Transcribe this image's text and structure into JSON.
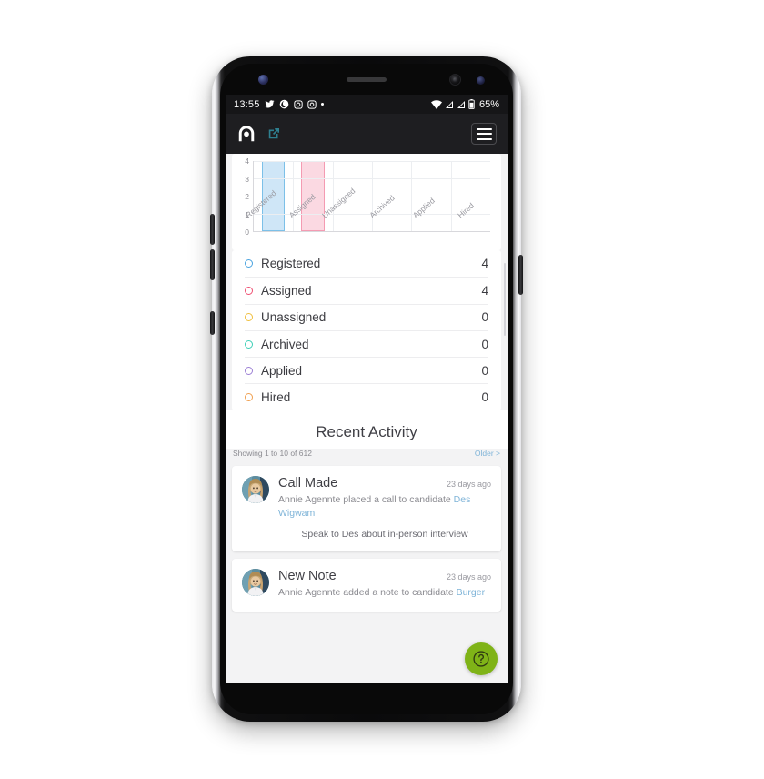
{
  "status_bar": {
    "time": "13:55",
    "battery_percent": "65%",
    "icons": [
      "twitter-icon",
      "vodafone-icon",
      "instagram-icon",
      "instagram-icon",
      "dot-icon"
    ],
    "right_icons": [
      "wifi-icon",
      "signal-icon",
      "signal-icon",
      "battery-icon"
    ]
  },
  "app_bar": {
    "logo": "app-logo-icon",
    "external_link": "external-link-icon",
    "menu": "hamburger-menu-icon"
  },
  "chart_data": {
    "type": "bar",
    "title": "",
    "categories": [
      "Registered",
      "Assigned",
      "Unassigned",
      "Archived",
      "Applied",
      "Hired"
    ],
    "values": [
      4,
      4,
      0,
      0,
      0,
      0
    ],
    "bar_colors": [
      "#cfe6f7",
      "#fbd9e2",
      "#fdeec2",
      "#c9efe6",
      "#ddd4f2",
      "#fae0c4"
    ],
    "bar_borders": [
      "#7cc0e8",
      "#f49bb2",
      "#f3cf6d",
      "#6fd4bf",
      "#b39ddb",
      "#efb06a"
    ],
    "yticks": [
      "0",
      "1",
      "2",
      "3",
      "4"
    ],
    "ylim": [
      0,
      4
    ],
    "xlabel": "",
    "ylabel": "",
    "grid": true,
    "legend_position": "below-as-list"
  },
  "stats": {
    "rows": [
      {
        "label": "Registered",
        "value": "4",
        "color": "#4aa3df"
      },
      {
        "label": "Assigned",
        "value": "4",
        "color": "#ef4f72"
      },
      {
        "label": "Unassigned",
        "value": "0",
        "color": "#f0c040"
      },
      {
        "label": "Archived",
        "value": "0",
        "color": "#3ecfb7"
      },
      {
        "label": "Applied",
        "value": "0",
        "color": "#9b7fd4"
      },
      {
        "label": "Hired",
        "value": "0",
        "color": "#f0a050"
      }
    ]
  },
  "recent_activity": {
    "heading": "Recent Activity",
    "showing_text": "Showing 1 to 10 of 612",
    "older_link": "Older >",
    "items": [
      {
        "avatar": "user-avatar",
        "title": "Call Made",
        "time": "23 days ago",
        "desc_prefix": "Annie Agennte placed a call to candidate ",
        "desc_link": "Des Wigwam",
        "note": "Speak to Des about in-person interview"
      },
      {
        "avatar": "user-avatar",
        "title": "New Note",
        "time": "23 days ago",
        "desc_prefix": "Annie Agennte added a note to candidate ",
        "desc_link": "Burger",
        "note": ""
      }
    ]
  },
  "help_button": {
    "icon": "question-mark-icon",
    "color": "#7fb317"
  },
  "theme": {
    "appbar_bg": "#1e1e21",
    "statusbar_bg": "#161618",
    "page_bg": "#f3f3f4",
    "link_color": "#7fb4d8",
    "accent_green": "#7fb317"
  }
}
